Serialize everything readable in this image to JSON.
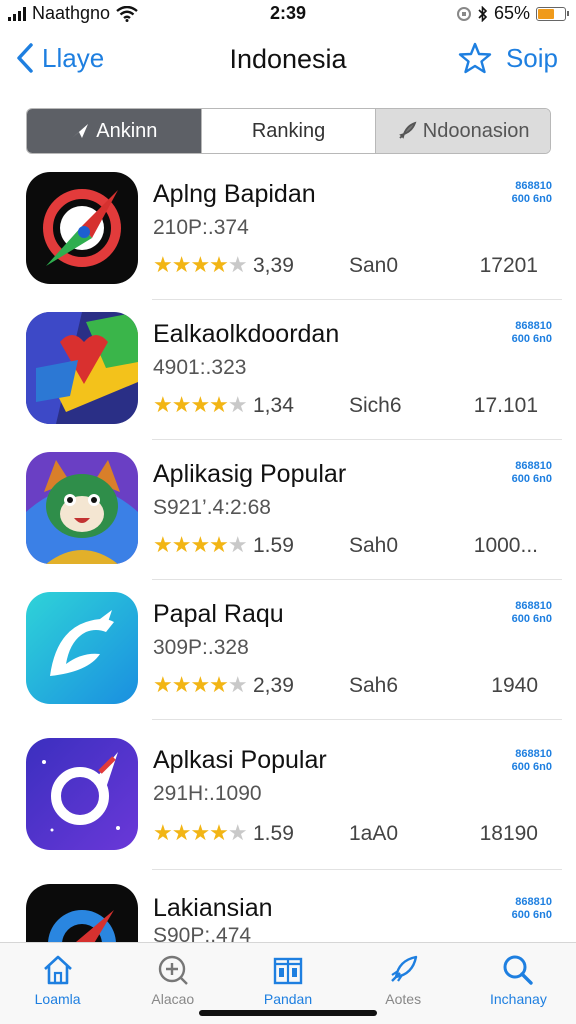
{
  "status": {
    "carrier": "Naathgno",
    "time": "2:39",
    "battery": "65%",
    "battery_level": 0.65
  },
  "nav": {
    "back_label": "Llaye",
    "title": "Indonesia",
    "right_label": "Soip"
  },
  "segments": [
    {
      "label": "Ankinn"
    },
    {
      "label": "Ranking"
    },
    {
      "label": "Ndoonasion"
    }
  ],
  "apps": [
    {
      "name": "Aplng Bapidan",
      "sub": "210P:.374",
      "rating": "3,39",
      "meta1": "San0",
      "meta2": "17201",
      "get": "868810 600 6n0",
      "stars": 4
    },
    {
      "name": "Ealkaolkdoordan",
      "sub": "4901:.323",
      "rating": "1,34",
      "meta1": "Sich6",
      "meta2": "17.101",
      "get": "868810 600 6n0",
      "stars": 4
    },
    {
      "name": "Aplikasig Popular",
      "sub": "S921’.4:2:68",
      "rating": "1.59",
      "meta1": "Sah0",
      "meta2": "1000...",
      "get": "868810 600 6n0",
      "stars": 4
    },
    {
      "name": "Papal Raqu",
      "sub": "309P:.328",
      "rating": "2,39",
      "meta1": "Sah6",
      "meta2": "1940",
      "get": "868810 600 6n0",
      "stars": 4
    },
    {
      "name": "Aplkasi Popular",
      "sub": "291H:.1090",
      "rating": "1.59",
      "meta1": "1aA0",
      "meta2": "18190",
      "get": "868810 600 6n0",
      "stars": 4
    },
    {
      "name": "Lakiansian",
      "sub": "S90P:.474",
      "rating": "",
      "meta1": "",
      "meta2": "",
      "get": "868810 600 6n0",
      "stars": 0
    }
  ],
  "tabs": [
    {
      "label": "Loamla"
    },
    {
      "label": "Alacao"
    },
    {
      "label": "Pandan"
    },
    {
      "label": "Aotes"
    },
    {
      "label": "Inchanay"
    }
  ],
  "colors": {
    "accent": "#1e7fe0",
    "star": "#f2b515",
    "segment_active": "#5d6066"
  },
  "icons": {
    "apps": [
      "compass-app-icon",
      "map-app-icon",
      "mascot-app-icon",
      "bird-app-icon",
      "orbit-app-icon",
      "compass-app-icon"
    ],
    "tabs": [
      "home-icon",
      "add-circle-icon",
      "book-icon",
      "rocket-icon",
      "search-icon"
    ]
  }
}
